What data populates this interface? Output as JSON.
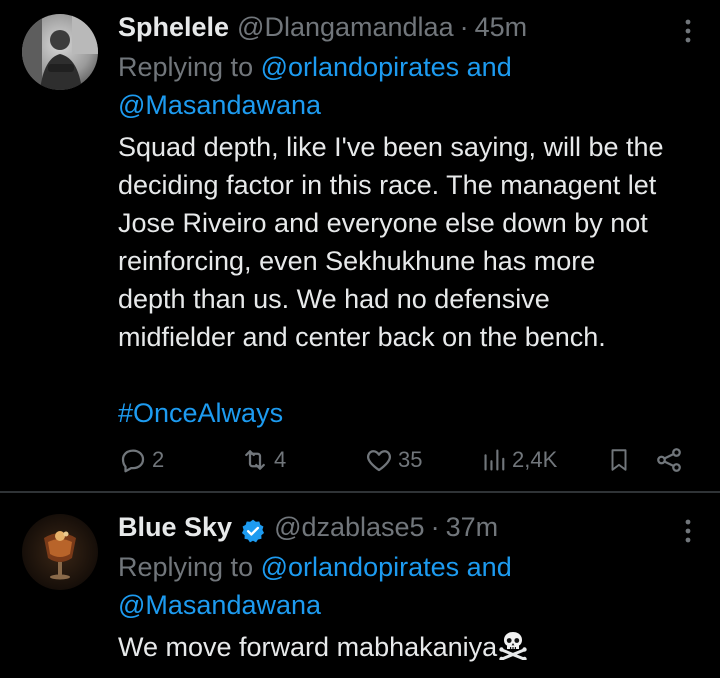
{
  "tweets": [
    {
      "name": "Sphelele",
      "handle": "@Dlangamandlaa",
      "separator": "·",
      "time": "45m",
      "reply_prefix": "Replying to",
      "reply_mention_1": "@orlandopirates",
      "reply_and": "and",
      "reply_mention_2": "@Masandawana",
      "body_lines": [
        "Squad depth, like I've been saying, will be the",
        "deciding factor in this race. The managent let",
        "Jose Riveiro and everyone else down by not",
        "reinforcing, even Sekhukhune has more",
        "depth than us. We had no defensive",
        "midfielder and center back on the bench."
      ],
      "hashtag": "#OnceAlways",
      "replies": "2",
      "retweets": "4",
      "likes": "35",
      "views": "2,4K"
    },
    {
      "name": "Blue Sky",
      "handle": "@dzablase5",
      "separator": "·",
      "time": "37m",
      "reply_prefix": "Replying to",
      "reply_mention_1": "@orlandopirates",
      "reply_and": "and",
      "reply_mention_2": "@Masandawana",
      "body_text": "We move forward mabhakaniya",
      "emoji": "skull-and-crossbones-icon"
    }
  ],
  "colors": {
    "background": "#000000",
    "text": "#e7e9ea",
    "muted": "#71767b",
    "link": "#1d9bf0",
    "divider": "#2f3336"
  }
}
